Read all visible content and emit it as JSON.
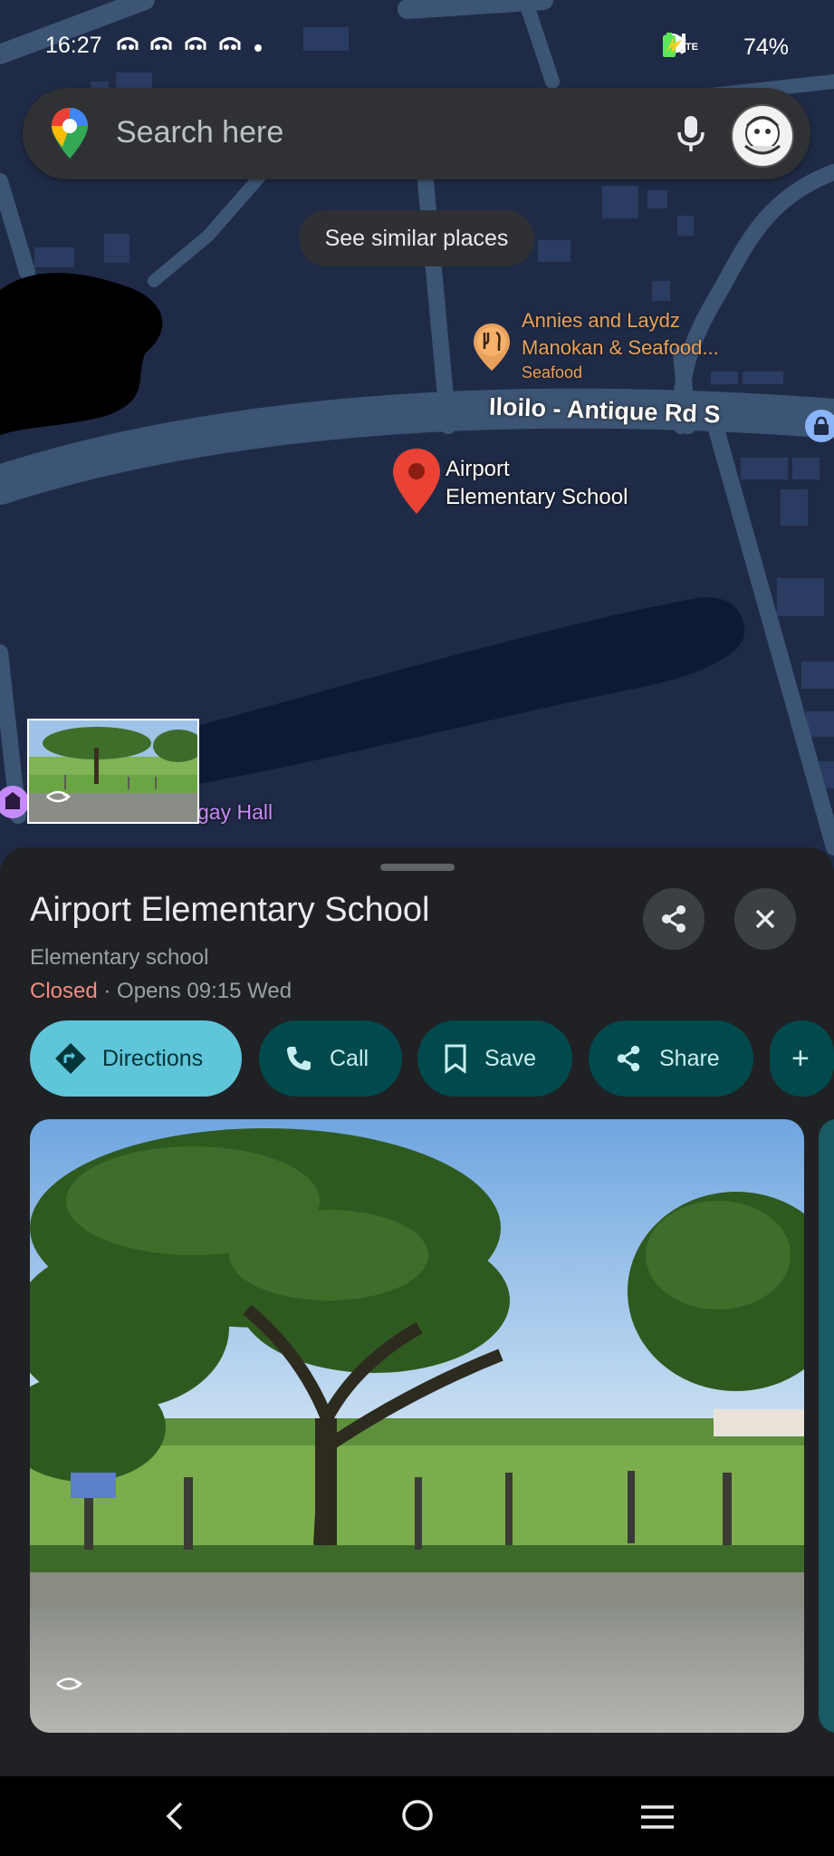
{
  "status_bar": {
    "time": "16:27",
    "battery": "74%",
    "signal_label": "LTE"
  },
  "search": {
    "placeholder": "Search here"
  },
  "map": {
    "similar_chip": "See similar places",
    "restaurant_name_line1": "Annies and Laydz",
    "restaurant_name_line2": "Manokan & Seafood...",
    "restaurant_category": "Seafood",
    "road_name": "Iloilo - Antique Rd S",
    "pin_label_line1": "Airport",
    "pin_label_line2": "Elementary School",
    "hall_label": "gay Hall"
  },
  "place": {
    "title": "Airport Elementary School",
    "category": "Elementary school",
    "status": "Closed",
    "hours": "Opens 09:15 Wed",
    "status_separator": " · "
  },
  "actions": [
    {
      "label": "Directions",
      "icon": "directions-icon"
    },
    {
      "label": "Call",
      "icon": "phone-icon"
    },
    {
      "label": "Save",
      "icon": "bookmark-icon"
    },
    {
      "label": "Share",
      "icon": "share-icon"
    },
    {
      "label": "+",
      "icon": "add-icon"
    }
  ],
  "colors": {
    "map_bg": "#1e2a44",
    "road": "#3f5a7a",
    "sheet_bg": "#202124",
    "action_bg": "#004a4d",
    "action_primary": "#5fc5d9",
    "closed": "#f28b82",
    "pin": "#ea4335"
  }
}
